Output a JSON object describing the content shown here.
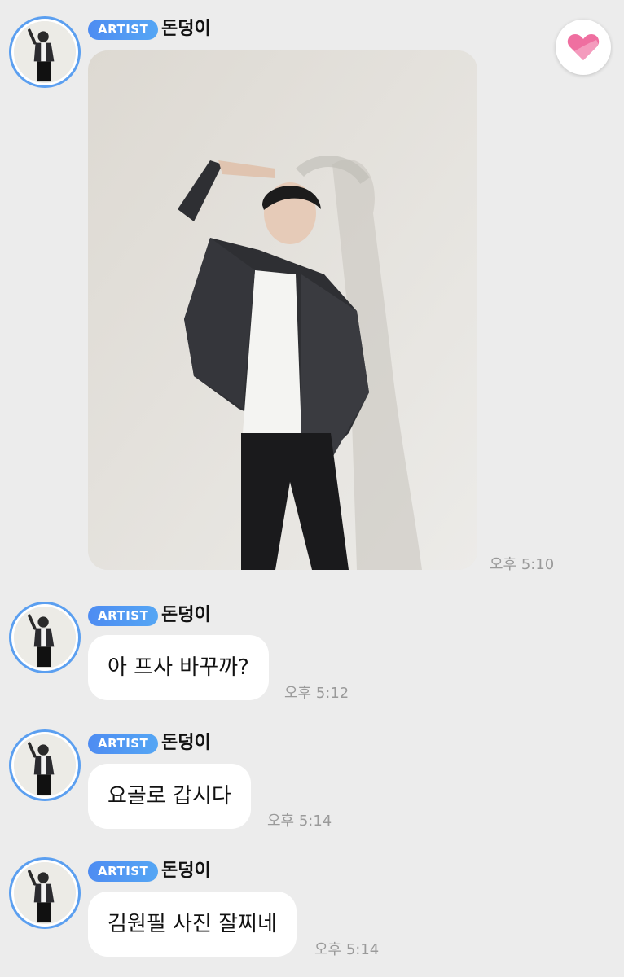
{
  "colors": {
    "background": "#ececec",
    "badge_start": "#4e8cf2",
    "badge_end": "#55a6f4",
    "avatar_ring": "#5b9ff0",
    "heart": "#ef6fa0",
    "bubble": "#ffffff"
  },
  "heart_button": {
    "icon": "heart-icon"
  },
  "messages": [
    {
      "badge": "ARTIST",
      "sender": "돈덩이",
      "type": "image",
      "image_desc": "photo-man-in-denim-jacket",
      "time": "오후 5:10"
    },
    {
      "badge": "ARTIST",
      "sender": "돈덩이",
      "type": "text",
      "text": "아 프사 바꾸까?",
      "time": "오후 5:12"
    },
    {
      "badge": "ARTIST",
      "sender": "돈덩이",
      "type": "text",
      "text": "요골로 갑시다",
      "time": "오후 5:14"
    },
    {
      "badge": "ARTIST",
      "sender": "돈덩이",
      "type": "text",
      "text": "김원필 사진 잘찌네",
      "time": "오후 5:14"
    }
  ]
}
